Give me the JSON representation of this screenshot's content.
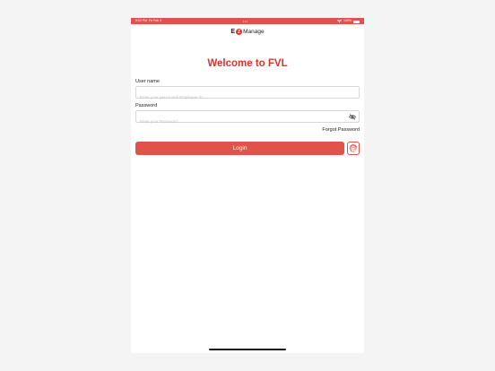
{
  "status_bar": {
    "time": "9:52 PM",
    "carrier": "Fri Feb 3",
    "center_dots": "•••",
    "battery_text": "100%",
    "wifi_icon": "wifi-icon",
    "battery_icon": "battery-icon"
  },
  "logo": {
    "prefix": "E",
    "badge": "Z",
    "suffix": "Manage"
  },
  "title": "Welcome to FVL",
  "username": {
    "label": "User name",
    "placeholder": "Enter your personnel/ Employee ID",
    "value": ""
  },
  "password": {
    "label": "Password",
    "placeholder": "Enter your Password",
    "value": "",
    "toggle_icon": "eye-off-icon"
  },
  "forgot_password": "Forgot Password",
  "login_button": "Login",
  "biometric_icon": "fingerprint-icon",
  "colors": {
    "accent": "#e0524a",
    "title": "#d9352b",
    "background": "#f4f4f4"
  }
}
